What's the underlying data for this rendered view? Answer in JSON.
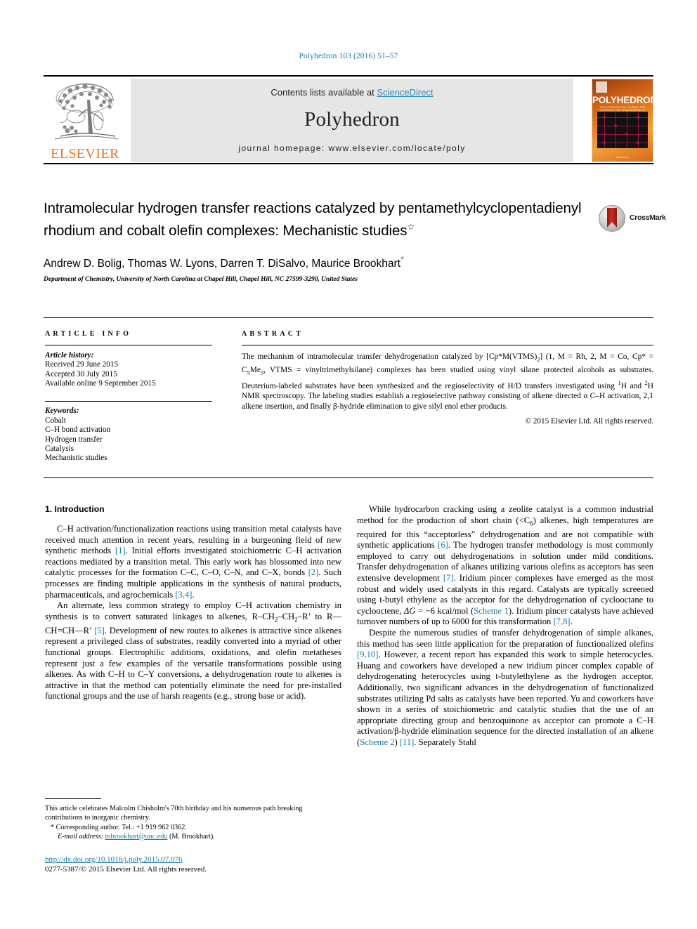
{
  "running_head": "Polyhedron 103 (2016) 51–57",
  "masthead": {
    "publisher_name": "ELSEVIER",
    "contents_prefix": "Contents lists available at ",
    "contents_link": "ScienceDirect",
    "journal_title": "Polyhedron",
    "homepage": "journal homepage: www.elsevier.com/locate/poly",
    "cover": {
      "journal_name": "POLYHEDRON",
      "subtitle": "THE INTERNATIONAL JOURNAL FOR INORGANIC AND ORGANOMETALLIC CHEMISTRY",
      "footer": "ScienceDirect"
    }
  },
  "article": {
    "title": "Intramolecular hydrogen transfer reactions catalyzed by pentamethylcyclopentadienyl rhodium and cobalt olefin complexes: Mechanistic studies",
    "title_footnote_marker": "☆",
    "authors": "Andrew D. Bolig, Thomas W. Lyons, Darren T. DiSalvo, Maurice Brookhart",
    "corresponding_marker": "*",
    "affiliation": "Department of Chemistry, University of North Carolina at Chapel Hill, Chapel Hill, NC 27599-3290, United States",
    "crossmark_label": "CrossMark"
  },
  "article_info": {
    "heading": "ARTICLE INFO",
    "history_label": "Article history:",
    "history": [
      "Received 29 June 2015",
      "Accepted 30 July 2015",
      "Available online 9 September 2015"
    ],
    "keywords_label": "Keywords:",
    "keywords": [
      "Cobalt",
      "C–H bond activation",
      "Hydrogen transfer",
      "Catalysis",
      "Mechanistic studies"
    ]
  },
  "abstract": {
    "heading": "ABSTRACT",
    "copyright": "© 2015 Elsevier Ltd. All rights reserved."
  },
  "body": {
    "section_title": "1. Introduction"
  },
  "footnotes": {
    "title_note": "This article celebrates Malcolm Chisholm's 70th birthday and his numerous path breaking contributions to inorganic chemistry.",
    "corresponding": "Corresponding author. Tel.: +1 919 962 0362.",
    "email_label": "E-mail address:",
    "email": "mbrookhart@unc.edu",
    "email_owner": "(M. Brookhart)."
  },
  "doi": {
    "url": "http://dx.doi.org/10.1016/j.poly.2015.07.076",
    "issn_line": "0277-5387/© 2015 Elsevier Ltd. All rights reserved."
  },
  "colors": {
    "link": "#1a7aa8",
    "elsevier_orange": "#e87722",
    "banner_gray": "#e6e6e6"
  }
}
